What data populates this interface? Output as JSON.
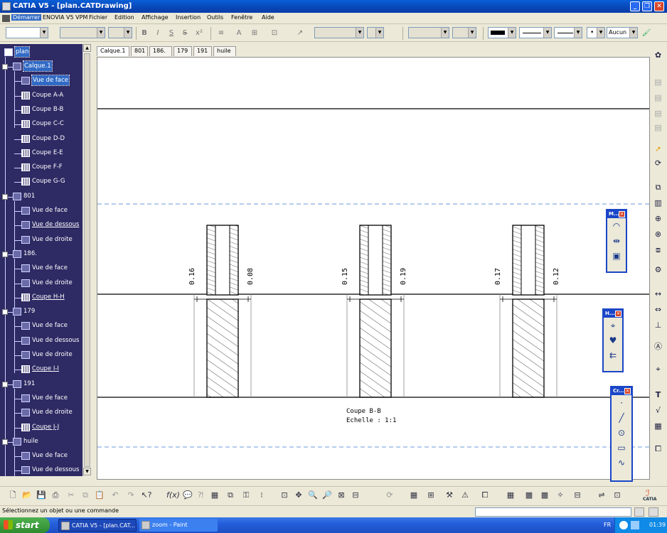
{
  "window": {
    "title": "CATIA V5 - [plan.CATDrawing]"
  },
  "menu": {
    "items": [
      "Démarrer",
      "ENOVIA V5 VPM",
      "Fichier",
      "Edition",
      "Affichage",
      "Insertion",
      "Outils",
      "Fenêtre",
      "Aide"
    ]
  },
  "toolbar": {
    "style_value": "",
    "font_value": "",
    "size_value": "",
    "line_style_value": "Aucun",
    "bold": "B",
    "italic": "I",
    "underline": "S",
    "strike": "S",
    "superscript": "x²"
  },
  "tree": {
    "root": "plan",
    "nodes": [
      {
        "label": "Calque.1",
        "kind": "sheet",
        "selected": true
      },
      {
        "label": "Vue de face",
        "kind": "view",
        "selected": true
      },
      {
        "label": "Coupe A-A",
        "kind": "section"
      },
      {
        "label": "Coupe B-B",
        "kind": "section"
      },
      {
        "label": "Coupe C-C",
        "kind": "section"
      },
      {
        "label": "Coupe D-D",
        "kind": "section"
      },
      {
        "label": "Coupe E-E",
        "kind": "section"
      },
      {
        "label": "Coupe F-F",
        "kind": "section"
      },
      {
        "label": "Coupe G-G",
        "kind": "section"
      },
      {
        "label": "801",
        "kind": "sheet"
      },
      {
        "label": "Vue de face",
        "kind": "view"
      },
      {
        "label": "Vue de dessous",
        "kind": "view",
        "underline": true
      },
      {
        "label": "Vue de droite",
        "kind": "view"
      },
      {
        "label": "186.",
        "kind": "sheet"
      },
      {
        "label": "Vue de face",
        "kind": "view"
      },
      {
        "label": "Vue de droite",
        "kind": "view"
      },
      {
        "label": "Coupe H-H",
        "kind": "section",
        "underline": true
      },
      {
        "label": "179",
        "kind": "sheet"
      },
      {
        "label": "Vue de face",
        "kind": "view"
      },
      {
        "label": "Vue de dessous",
        "kind": "view"
      },
      {
        "label": "Vue de droite",
        "kind": "view"
      },
      {
        "label": "Coupe I-I",
        "kind": "section",
        "underline": true
      },
      {
        "label": "191",
        "kind": "sheet"
      },
      {
        "label": "Vue de face",
        "kind": "view"
      },
      {
        "label": "Vue de droite",
        "kind": "view"
      },
      {
        "label": "Coupe J-J",
        "kind": "section",
        "underline": true
      },
      {
        "label": "huile",
        "kind": "sheet"
      },
      {
        "label": "Vue de face",
        "kind": "view"
      },
      {
        "label": "Vue de dessous",
        "kind": "view"
      }
    ]
  },
  "sheet_tabs": [
    "Calque.1",
    "801",
    "186.",
    "179",
    "191",
    "huile"
  ],
  "drawing": {
    "dimensions": [
      "0.16",
      "0.08",
      "0.15",
      "0.19",
      "0.17",
      "0.12"
    ],
    "caption_line1": "Coupe B-B",
    "caption_line2": "Echelle :  1:1"
  },
  "palettes": [
    {
      "title": "M..."
    },
    {
      "title": "H..."
    },
    {
      "title": "Cr..."
    }
  ],
  "status": {
    "message": "Sélectionnez un objet ou une commande"
  },
  "taskbar": {
    "start": "start",
    "tasks": [
      "CATIA V5 - [plan.CAT...",
      "zoom - Paint"
    ],
    "lang": "FR",
    "time": "01:39"
  },
  "brand": {
    "catia": "CATIA"
  },
  "colors": {
    "tree_bg": "#2e2a64",
    "title_blue": "#0a5fd8",
    "palette_border": "#1a46c8",
    "dash": "#6a9bd8"
  }
}
